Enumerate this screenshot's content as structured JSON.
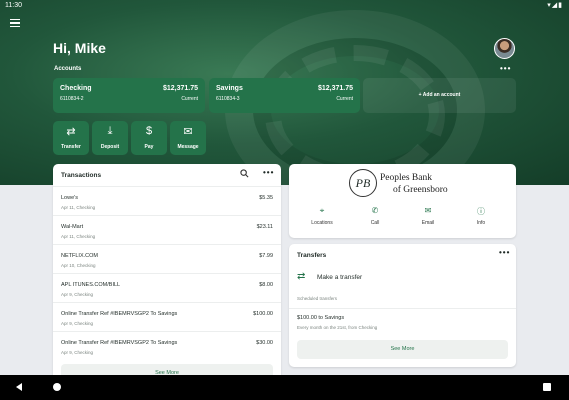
{
  "status": {
    "time": "11:30",
    "icons": "▾◢▮"
  },
  "header": {
    "greeting": "Hi, Mike",
    "accounts_label": "Accounts",
    "more": "•••"
  },
  "accounts": [
    {
      "name": "Checking",
      "number": "6110834-2",
      "balance": "$12,371.75",
      "status": "Current"
    },
    {
      "name": "Savings",
      "number": "6110834-3",
      "balance": "$12,371.75",
      "status": "Current"
    }
  ],
  "add_account": "+ Add an account",
  "quick_actions": [
    {
      "label": "Transfer",
      "icon": "⇄"
    },
    {
      "label": "Deposit",
      "icon": "⤓"
    },
    {
      "label": "Pay",
      "icon": "$"
    },
    {
      "label": "Message",
      "icon": "✉"
    }
  ],
  "transactions": {
    "title": "Transactions",
    "more": "•••",
    "see_more": "See More",
    "rows": [
      {
        "desc": "Lowe's",
        "meta": "Apr 11, Checking",
        "amount": "$5.35"
      },
      {
        "desc": "Wal-Mart",
        "meta": "Apr 11, Checking",
        "amount": "$23.11"
      },
      {
        "desc": "NETFLIX.COM",
        "meta": "Apr 10, Checking",
        "amount": "$7.99"
      },
      {
        "desc": "APL ITUNES.COM/BILL",
        "meta": "Apr 9, Checking",
        "amount": "$8.00"
      },
      {
        "desc": "Online Transfer Ref #IBEMRVSGP2 To Savings",
        "meta": "Apr 9, Checking",
        "amount": "$100.00"
      },
      {
        "desc": "Online Transfer Ref #IBEMRVSGP2 To Savings",
        "meta": "Apr 9, Checking",
        "amount": "$30.00"
      }
    ]
  },
  "bank": {
    "seal": "PB",
    "name_line1": "Peoples Bank",
    "name_line2": "of Greensboro",
    "actions": [
      {
        "label": "Locations",
        "icon": "⌖"
      },
      {
        "label": "Call",
        "icon": "✆"
      },
      {
        "label": "Email",
        "icon": "✉"
      },
      {
        "label": "Info",
        "icon": "ⓘ"
      }
    ]
  },
  "transfers": {
    "title": "Transfers",
    "more": "•••",
    "make_label": "Make a transfer",
    "make_icon": "⇄",
    "scheduled_label": "Scheduled transfers",
    "item_amount": "$100.00 to Savings",
    "item_meta": "Every month on the 21st, from Checking",
    "see_more": "See More"
  },
  "colors": {
    "brand": "#24734a",
    "hero": "#21573b"
  }
}
